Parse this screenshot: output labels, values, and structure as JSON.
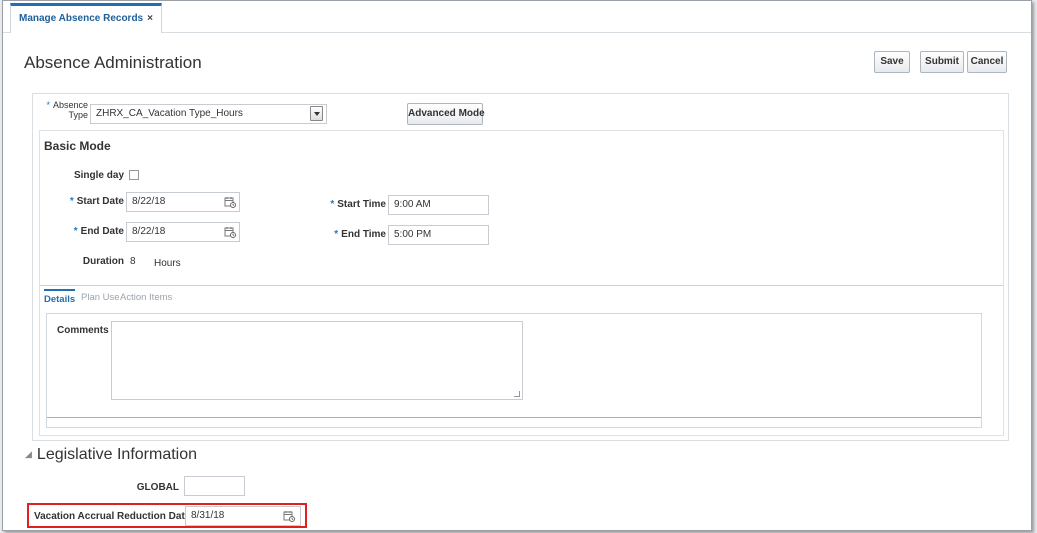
{
  "tab": {
    "label": "Manage Absence Records",
    "close": "×"
  },
  "page_title": "Absence Administration",
  "toolbar": {
    "save": "Save",
    "submit": "Submit",
    "cancel": "Cancel"
  },
  "absence_type": {
    "label_line1": "Absence",
    "label_line2": "Type",
    "value": "ZHRX_CA_Vacation Type_Hours",
    "required": "*"
  },
  "advanced_mode": "Advanced Mode",
  "basic_mode": {
    "title": "Basic Mode",
    "single_day_label": "Single day",
    "start_date_label": "Start Date",
    "start_date_value": "8/22/18",
    "end_date_label": "End Date",
    "end_date_value": "8/22/18",
    "start_time_label": "Start Time",
    "start_time_value": "9:00 AM",
    "end_time_label": "End Time",
    "end_time_value": "5:00 PM",
    "duration_label": "Duration",
    "duration_value": "8",
    "duration_unit": "Hours"
  },
  "subtabs": {
    "details": "Details",
    "plan_use": "Plan Use",
    "action_items": "Action Items"
  },
  "details": {
    "comments_label": "Comments",
    "comments_value": ""
  },
  "legislative": {
    "title": "Legislative Information",
    "global_label": "GLOBAL",
    "global_value": "",
    "reduction_label": "Vacation Accrual Reduction Date",
    "reduction_value": "8/31/18"
  },
  "colors": {
    "accent": "#1f6fb2",
    "highlight": "#e02020",
    "required": "#2f74b5"
  }
}
